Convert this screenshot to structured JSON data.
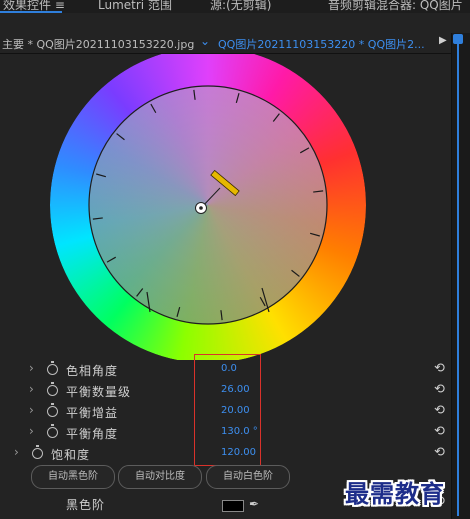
{
  "tabs": [
    {
      "label": "效果控件 ≡"
    },
    {
      "label": "Lumetri 范围"
    },
    {
      "label": "源:(无剪辑)"
    },
    {
      "label": "音频剪辑混合器: QQ图片"
    }
  ],
  "header": {
    "master_clip": "主要 * QQ图片20211103153220.jpg",
    "dropdown_icon": "chevron-down",
    "sequence_clip": "QQ图片20211103153220 * QQ图片2...",
    "play_icon": "triangle-right"
  },
  "wheel": {
    "hue_angle_deg": 0.0,
    "balance_angle_deg": 130.0
  },
  "properties": [
    {
      "label": "色相角度",
      "value": "0.0",
      "expand_icon": "chevron-right",
      "stopwatch_icon": "stopwatch",
      "reset_icon": "reset"
    },
    {
      "label": "平衡数量级",
      "value": "26.00",
      "expand_icon": "chevron-right",
      "stopwatch_icon": "stopwatch",
      "reset_icon": "reset"
    },
    {
      "label": "平衡增益",
      "value": "20.00",
      "expand_icon": "chevron-right",
      "stopwatch_icon": "stopwatch",
      "reset_icon": "reset"
    },
    {
      "label": "平衡角度",
      "value": "130.0 °",
      "expand_icon": "chevron-right",
      "stopwatch_icon": "stopwatch",
      "reset_icon": "reset"
    },
    {
      "label": "饱和度",
      "value": "120.00",
      "expand_icon": "chevron-right",
      "stopwatch_icon": "stopwatch",
      "reset_icon": "reset"
    }
  ],
  "buttons": {
    "auto_black": "自动黑色阶",
    "auto_contrast": "自动对比度",
    "auto_white": "自动白色阶"
  },
  "black_level": {
    "label": "黑色阶",
    "color": "#000000",
    "eyedropper_icon": "eyedropper",
    "reset_icon": "reset"
  },
  "watermark": "最需教育",
  "colors": {
    "accent_blue": "#3d8ff0",
    "highlight_red": "#d9322b",
    "handle_yellow": "#e6b800"
  }
}
